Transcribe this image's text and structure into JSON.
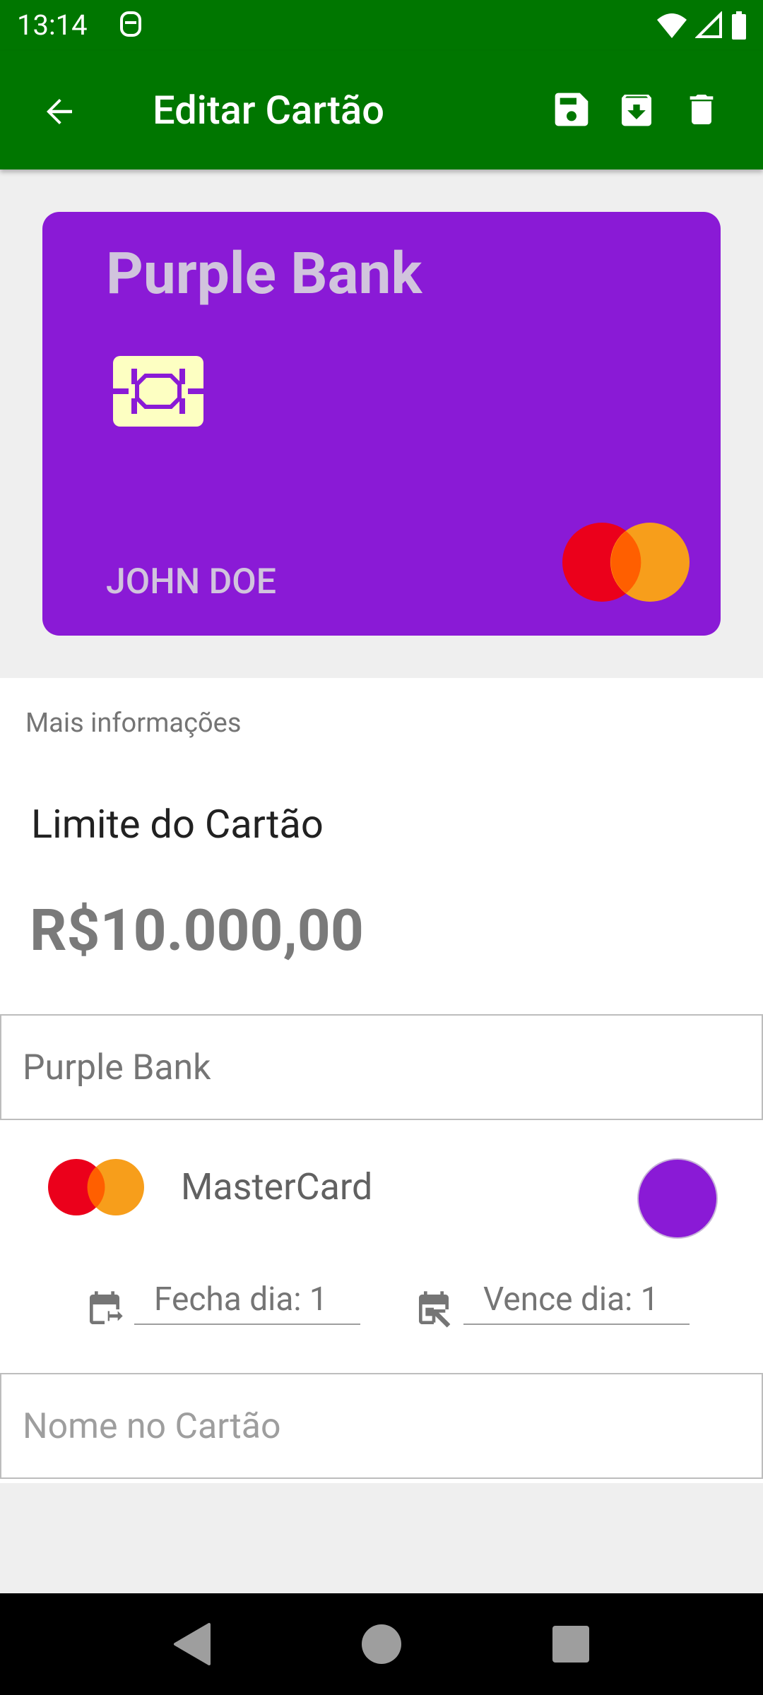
{
  "status_bar": {
    "time": "13:14"
  },
  "app_bar": {
    "title": "Editar Cartão",
    "icons": [
      "arrow-back-icon",
      "save-icon",
      "archive-download-icon",
      "trash-icon"
    ]
  },
  "card_preview": {
    "bank_name": "Purple Bank",
    "holder_name": "JOHN DOE",
    "background_color": "#8a1ad6",
    "brand": "mastercard"
  },
  "info": {
    "section_label": "Mais informações",
    "limit_label": "Limite do Cartão",
    "limit_value": "R$10.000,00"
  },
  "form": {
    "bank_name_value": "Purple Bank",
    "brand_label": "MasterCard",
    "selected_color": "#8a1ad6",
    "closing_day": "Fecha dia: 1",
    "due_day": "Vence dia: 1",
    "card_name_placeholder": "Nome no Cartão"
  },
  "colors": {
    "primary": "#007600",
    "card_purple": "#8a1ad6",
    "mastercard_red": "#eb001b",
    "mastercard_orange": "#f79e1b"
  }
}
